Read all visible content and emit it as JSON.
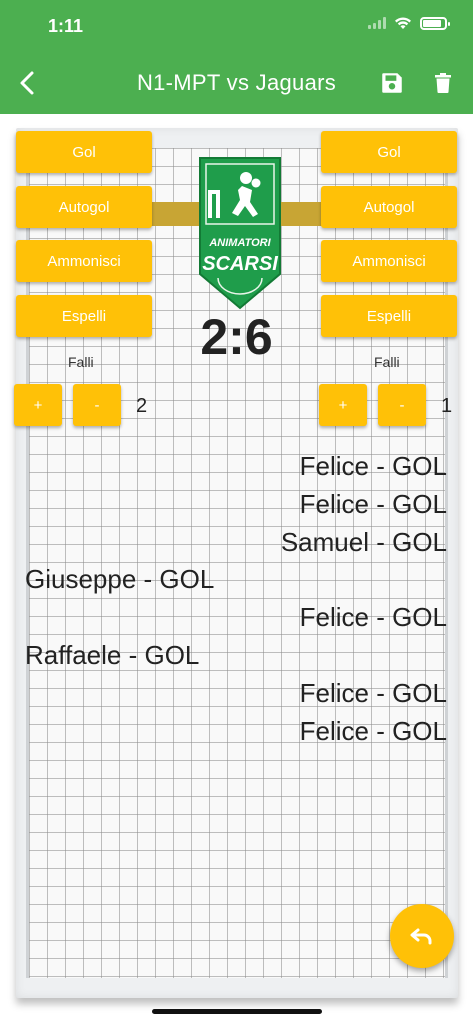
{
  "status_bar": {
    "time": "1:11"
  },
  "app_bar": {
    "title": "N1-MPT vs Jaguars",
    "back_icon": "back-arrow-icon",
    "save_icon": "save-icon",
    "delete_icon": "trash-icon"
  },
  "colors": {
    "primary": "#4caf50",
    "accent": "#ffc107"
  },
  "home_team": {
    "buttons": {
      "goal": "Gol",
      "own_goal": "Autogol",
      "warn": "Ammonisci",
      "expel": "Espelli"
    },
    "fouls_label": "Falli",
    "foul_plus": "+",
    "foul_minus": "-",
    "fouls": "2"
  },
  "away_team": {
    "buttons": {
      "goal": "Gol",
      "own_goal": "Autogol",
      "warn": "Ammonisci",
      "expel": "Espelli"
    },
    "fouls_label": "Falli",
    "foul_plus": "+",
    "foul_minus": "-",
    "fouls": "1"
  },
  "logo": {
    "line1": "ANIMATORI",
    "line2": "SCARSI"
  },
  "score": "2:6",
  "events": [
    {
      "text": "Felice - GOL",
      "side": "right"
    },
    {
      "text": "Felice - GOL",
      "side": "right"
    },
    {
      "text": "Samuel - GOL",
      "side": "right"
    },
    {
      "text": "Giuseppe - GOL",
      "side": "left"
    },
    {
      "text": "Felice - GOL",
      "side": "right"
    },
    {
      "text": "Raffaele - GOL",
      "side": "left"
    },
    {
      "text": "Felice - GOL",
      "side": "right"
    },
    {
      "text": "Felice - GOL",
      "side": "right"
    }
  ],
  "fab_icon": "undo-icon"
}
